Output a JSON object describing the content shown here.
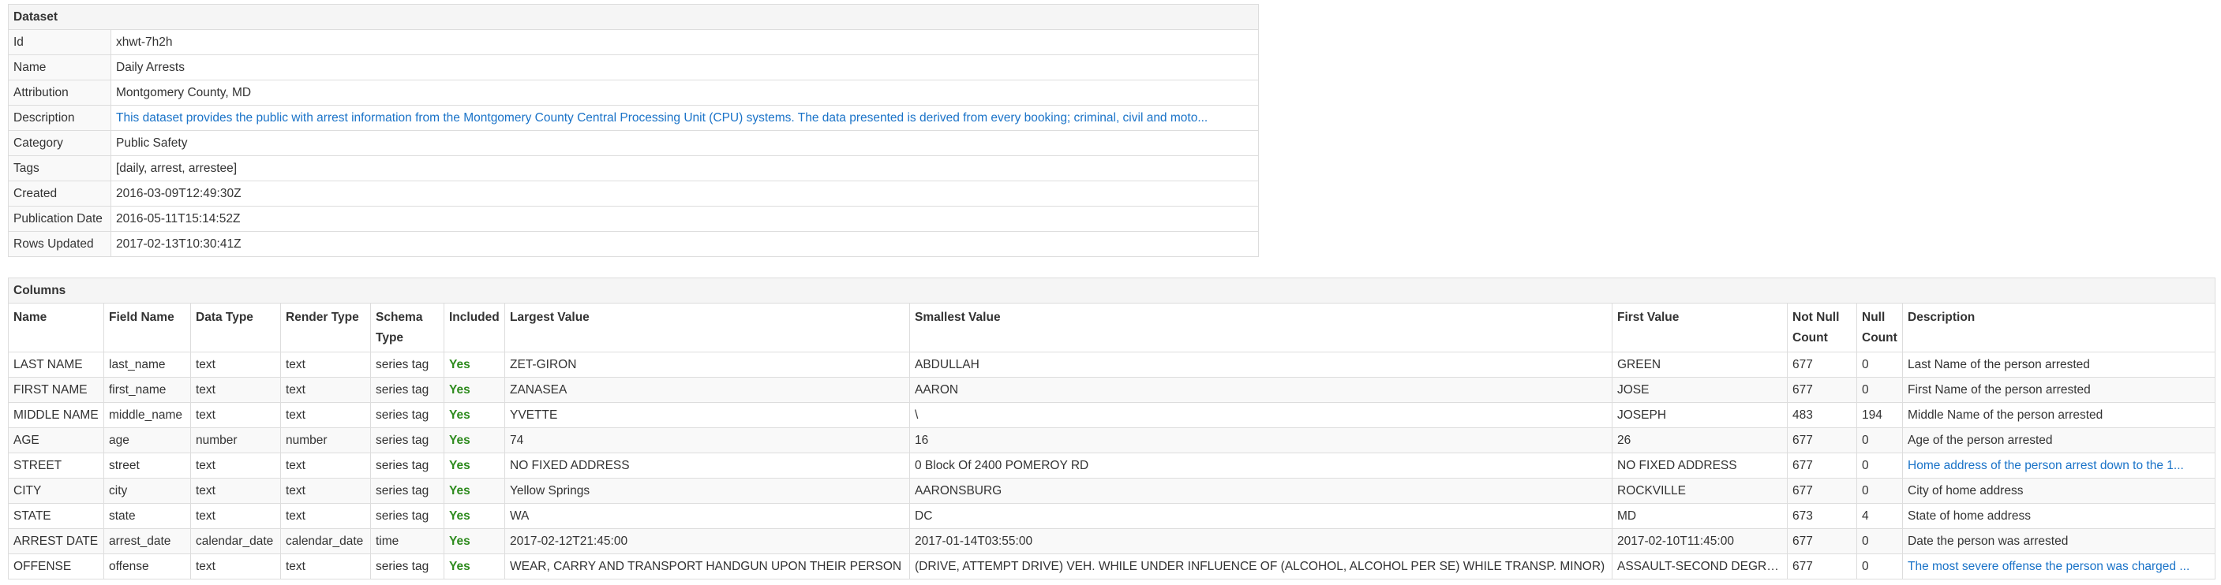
{
  "dataset": {
    "caption": "Dataset",
    "rows": [
      {
        "key": "Id",
        "value": "xhwt-7h2h"
      },
      {
        "key": "Name",
        "value": "Daily Arrests"
      },
      {
        "key": "Attribution",
        "value": "Montgomery County, MD"
      },
      {
        "key": "Description",
        "value": "This dataset provides the public with arrest information from the Montgomery County Central Processing Unit (CPU) systems. The data presented is derived from every booking; criminal, civil and moto..."
      },
      {
        "key": "Category",
        "value": "Public Safety"
      },
      {
        "key": "Tags",
        "value": "[daily, arrest, arrestee]"
      },
      {
        "key": "Created",
        "value": "2016-03-09T12:49:30Z"
      },
      {
        "key": "Publication Date",
        "value": "2016-05-11T15:14:52Z"
      },
      {
        "key": "Rows Updated",
        "value": "2017-02-13T10:30:41Z"
      }
    ]
  },
  "columns": {
    "caption": "Columns",
    "headers": [
      "Name",
      "Field Name",
      "Data Type",
      "Render Type",
      "Schema Type",
      "Included",
      "Largest Value",
      "Smallest Value",
      "First Value",
      "Not Null Count",
      "Null Count",
      "Description"
    ],
    "rows": [
      [
        "LAST NAME",
        "last_name",
        "text",
        "text",
        "series tag",
        "Yes",
        "ZET-GIRON",
        "ABDULLAH",
        "GREEN",
        "677",
        "0",
        "Last Name of the person arrested"
      ],
      [
        "FIRST NAME",
        "first_name",
        "text",
        "text",
        "series tag",
        "Yes",
        "ZANASEA",
        "AARON",
        "JOSE",
        "677",
        "0",
        "First Name of the person arrested"
      ],
      [
        "MIDDLE NAME",
        "middle_name",
        "text",
        "text",
        "series tag",
        "Yes",
        "YVETTE",
        "\\",
        "JOSEPH",
        "483",
        "194",
        "Middle Name of the person arrested"
      ],
      [
        "AGE",
        "age",
        "number",
        "number",
        "series tag",
        "Yes",
        "74",
        "16",
        "26",
        "677",
        "0",
        "Age of the person arrested"
      ],
      [
        "STREET",
        "street",
        "text",
        "text",
        "series tag",
        "Yes",
        "NO FIXED ADDRESS",
        "0 Block Of 2400 POMEROY RD",
        "NO FIXED ADDRESS",
        "677",
        "0",
        "Home address of the person arrest down to the 1..."
      ],
      [
        "CITY",
        "city",
        "text",
        "text",
        "series tag",
        "Yes",
        "Yellow Springs",
        "AARONSBURG",
        "ROCKVILLE",
        "677",
        "0",
        "City of home address"
      ],
      [
        "STATE",
        "state",
        "text",
        "text",
        "series tag",
        "Yes",
        "WA",
        "DC",
        "MD",
        "673",
        "4",
        "State of home address"
      ],
      [
        "ARREST DATE",
        "arrest_date",
        "calendar_date",
        "calendar_date",
        "time",
        "Yes",
        "2017-02-12T21:45:00",
        "2017-01-14T03:55:00",
        "2017-02-10T11:45:00",
        "677",
        "0",
        "Date the person was arrested"
      ],
      [
        "OFFENSE",
        "offense",
        "text",
        "text",
        "series tag",
        "Yes",
        "WEAR, CARRY AND TRANSPORT HANDGUN UPON THEIR PERSON",
        "(DRIVE, ATTEMPT DRIVE) VEH. WHILE UNDER INFLUENCE OF (ALCOHOL, ALCOHOL PER SE) WHILE TRANSP. MINOR)",
        "ASSAULT-SECOND DEGREE",
        "677",
        "0",
        "The most severe offense the person was charged ..."
      ]
    ]
  },
  "colors": {
    "link": "#1a73c8",
    "yes": "#2e8b1e",
    "border": "#dddddd",
    "header_bg": "#f5f5f5"
  }
}
